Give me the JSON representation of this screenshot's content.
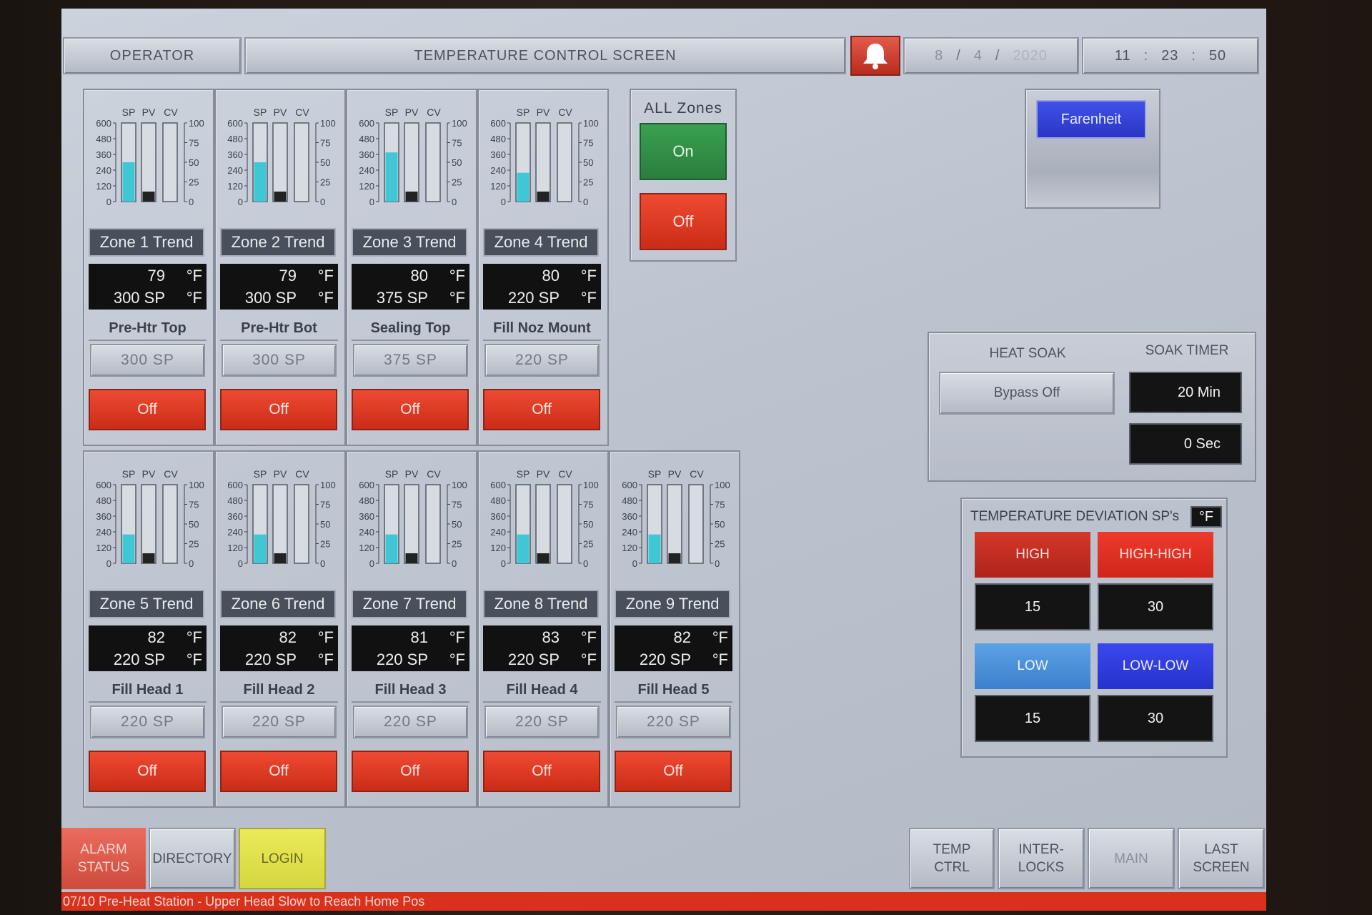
{
  "header": {
    "user": "OPERATOR",
    "title": "TEMPERATURE CONTROL SCREEN",
    "date": {
      "month": "8",
      "day": "4",
      "year": "2020"
    },
    "time": {
      "hour": "11",
      "minute": "23",
      "second": "50"
    }
  },
  "gauge_labels": {
    "sp": "SP",
    "pv": "PV",
    "cv": "CV",
    "left_ticks": [
      "600",
      "480",
      "360",
      "240",
      "120",
      "0"
    ],
    "right_ticks": [
      "100",
      "75",
      "50",
      "25",
      "0"
    ]
  },
  "zones": [
    {
      "trend": "Zone 1 Trend",
      "pv": "79",
      "sp_display": "300 SP",
      "unit": "°F",
      "name": "Pre-Htr Top",
      "sp_entry": "300  SP",
      "state": "Off",
      "sp_level": 300,
      "pv_level": 79,
      "cv_level": 0
    },
    {
      "trend": "Zone 2 Trend",
      "pv": "79",
      "sp_display": "300 SP",
      "unit": "°F",
      "name": "Pre-Htr Bot",
      "sp_entry": "300  SP",
      "state": "Off",
      "sp_level": 300,
      "pv_level": 79,
      "cv_level": 0
    },
    {
      "trend": "Zone 3 Trend",
      "pv": "80",
      "sp_display": "375 SP",
      "unit": "°F",
      "name": "Sealing Top",
      "sp_entry": "375  SP",
      "state": "Off",
      "sp_level": 375,
      "pv_level": 80,
      "cv_level": 0
    },
    {
      "trend": "Zone 4 Trend",
      "pv": "80",
      "sp_display": "220 SP",
      "unit": "°F",
      "name": "Fill Noz Mount",
      "sp_entry": "220  SP",
      "state": "Off",
      "sp_level": 220,
      "pv_level": 80,
      "cv_level": 0
    },
    {
      "trend": "Zone 5 Trend",
      "pv": "82",
      "sp_display": "220 SP",
      "unit": "°F",
      "name": "Fill Head 1",
      "sp_entry": "220  SP",
      "state": "Off",
      "sp_level": 220,
      "pv_level": 82,
      "cv_level": 0
    },
    {
      "trend": "Zone 6 Trend",
      "pv": "82",
      "sp_display": "220 SP",
      "unit": "°F",
      "name": "Fill Head 2",
      "sp_entry": "220  SP",
      "state": "Off",
      "sp_level": 220,
      "pv_level": 82,
      "cv_level": 0
    },
    {
      "trend": "Zone 7 Trend",
      "pv": "81",
      "sp_display": "220 SP",
      "unit": "°F",
      "name": "Fill Head 3",
      "sp_entry": "220  SP",
      "state": "Off",
      "sp_level": 220,
      "pv_level": 81,
      "cv_level": 0
    },
    {
      "trend": "Zone 8 Trend",
      "pv": "83",
      "sp_display": "220 SP",
      "unit": "°F",
      "name": "Fill Head 4",
      "sp_entry": "220  SP",
      "state": "Off",
      "sp_level": 220,
      "pv_level": 83,
      "cv_level": 0
    },
    {
      "trend": "Zone 9 Trend",
      "pv": "82",
      "sp_display": "220 SP",
      "unit": "°F",
      "name": "Fill Head 5",
      "sp_entry": "220  SP",
      "state": "Off",
      "sp_level": 220,
      "pv_level": 82,
      "cv_level": 0
    }
  ],
  "all_zones": {
    "title": "ALL Zones",
    "on": "On",
    "off": "Off"
  },
  "units_button": "Farenheit",
  "heat_soak": {
    "title": "HEAT SOAK",
    "bypass": "Bypass Off",
    "timer_title": "SOAK TIMER",
    "minutes": "20 Min",
    "seconds": "0 Sec"
  },
  "deviation": {
    "title": "TEMPERATURE DEVIATION SP's",
    "unit": "°F",
    "high_label": "HIGH",
    "high_value": "15",
    "highhigh_label": "HIGH-HIGH",
    "highhigh_value": "30",
    "low_label": "LOW",
    "low_value": "15",
    "lowlow_label": "LOW-LOW",
    "lowlow_value": "30"
  },
  "nav": {
    "alarm_status": "ALARM STATUS",
    "directory": "DIRECTORY",
    "login": "LOGIN",
    "temp_ctrl": "TEMP CTRL",
    "interlocks": "INTER- LOCKS",
    "main": "MAIN",
    "last_screen": "LAST SCREEN"
  },
  "alarm_message": "07/10 Pre-Heat Station - Upper  Head Slow to Reach Home Pos",
  "colors": {
    "bar_fill": "#3fc7d6",
    "off_red": "#e03a24",
    "on_green": "#2f8f45",
    "low_blue": "#4a90d8",
    "lowlow_blue": "#2f3ee0",
    "high_red": "#c82a20"
  },
  "chart_data": {
    "type": "bar",
    "categories": [
      "Zone 1",
      "Zone 2",
      "Zone 3",
      "Zone 4",
      "Zone 5",
      "Zone 6",
      "Zone 7",
      "Zone 8",
      "Zone 9"
    ],
    "series": [
      {
        "name": "SP",
        "values": [
          300,
          300,
          375,
          220,
          220,
          220,
          220,
          220,
          220
        ]
      },
      {
        "name": "PV",
        "values": [
          79,
          79,
          80,
          80,
          82,
          82,
          81,
          83,
          82
        ]
      },
      {
        "name": "CV",
        "values": [
          0,
          0,
          0,
          0,
          0,
          0,
          0,
          0,
          0
        ]
      }
    ],
    "ylim": [
      0,
      600
    ],
    "ylim_right": [
      0,
      100
    ]
  }
}
